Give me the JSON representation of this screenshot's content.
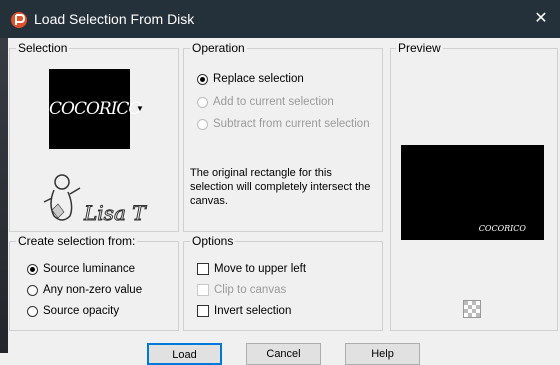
{
  "window": {
    "title": "Load Selection From Disk",
    "close_glyph": "✕"
  },
  "selection": {
    "title": "Selection",
    "thumbnail_text": "COCORICO",
    "dropdown_glyph": "▼",
    "watermark_text": "Lisa T"
  },
  "operation": {
    "title": "Operation",
    "options": [
      {
        "label": "Replace selection",
        "checked": true,
        "disabled": false
      },
      {
        "label": "Add to current selection",
        "checked": false,
        "disabled": true
      },
      {
        "label": "Subtract from current selection",
        "checked": false,
        "disabled": true
      }
    ],
    "description": "The original rectangle for this selection will completely intersect the canvas."
  },
  "preview": {
    "title": "Preview",
    "preview_text": "COCORICO"
  },
  "create_from": {
    "title": "Create selection from:",
    "options": [
      {
        "label": "Source luminance",
        "checked": true
      },
      {
        "label": "Any non-zero value",
        "checked": false
      },
      {
        "label": "Source opacity",
        "checked": false
      }
    ]
  },
  "options": {
    "title": "Options",
    "items": [
      {
        "label": "Move to upper left",
        "checked": false,
        "disabled": false
      },
      {
        "label": "Clip to canvas",
        "checked": false,
        "disabled": true
      },
      {
        "label": "Invert selection",
        "checked": false,
        "disabled": false
      }
    ]
  },
  "buttons": {
    "load": "Load",
    "cancel": "Cancel",
    "help": "Help"
  },
  "colors": {
    "titlebar": "#24313b",
    "dialog_bg": "#f0f0f0",
    "accent": "#0078d7",
    "app_icon": "#e0502b"
  }
}
